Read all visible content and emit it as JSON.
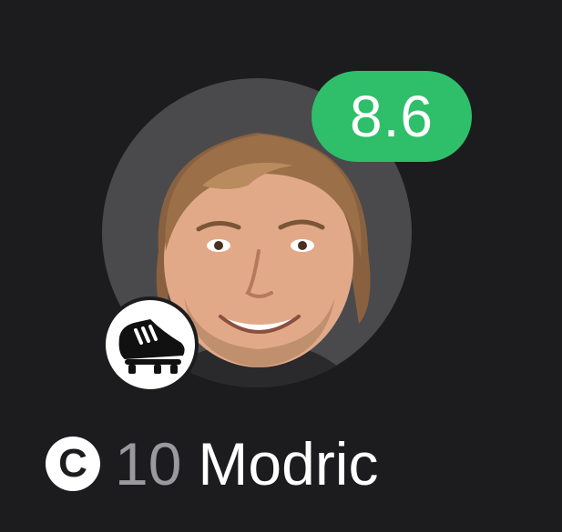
{
  "player": {
    "rating": "8.6",
    "captain_mark": "C",
    "shirt_number": "10",
    "name": "Modric",
    "avatar_icon": "player-photo",
    "badge_icon": "football-boot-icon"
  },
  "colors": {
    "background": "#1c1c1e",
    "rating_badge": "#2fbf6b",
    "avatar_ring": "#4a4a4c",
    "number_text": "#9a9a9e",
    "name_text": "#ffffff"
  }
}
